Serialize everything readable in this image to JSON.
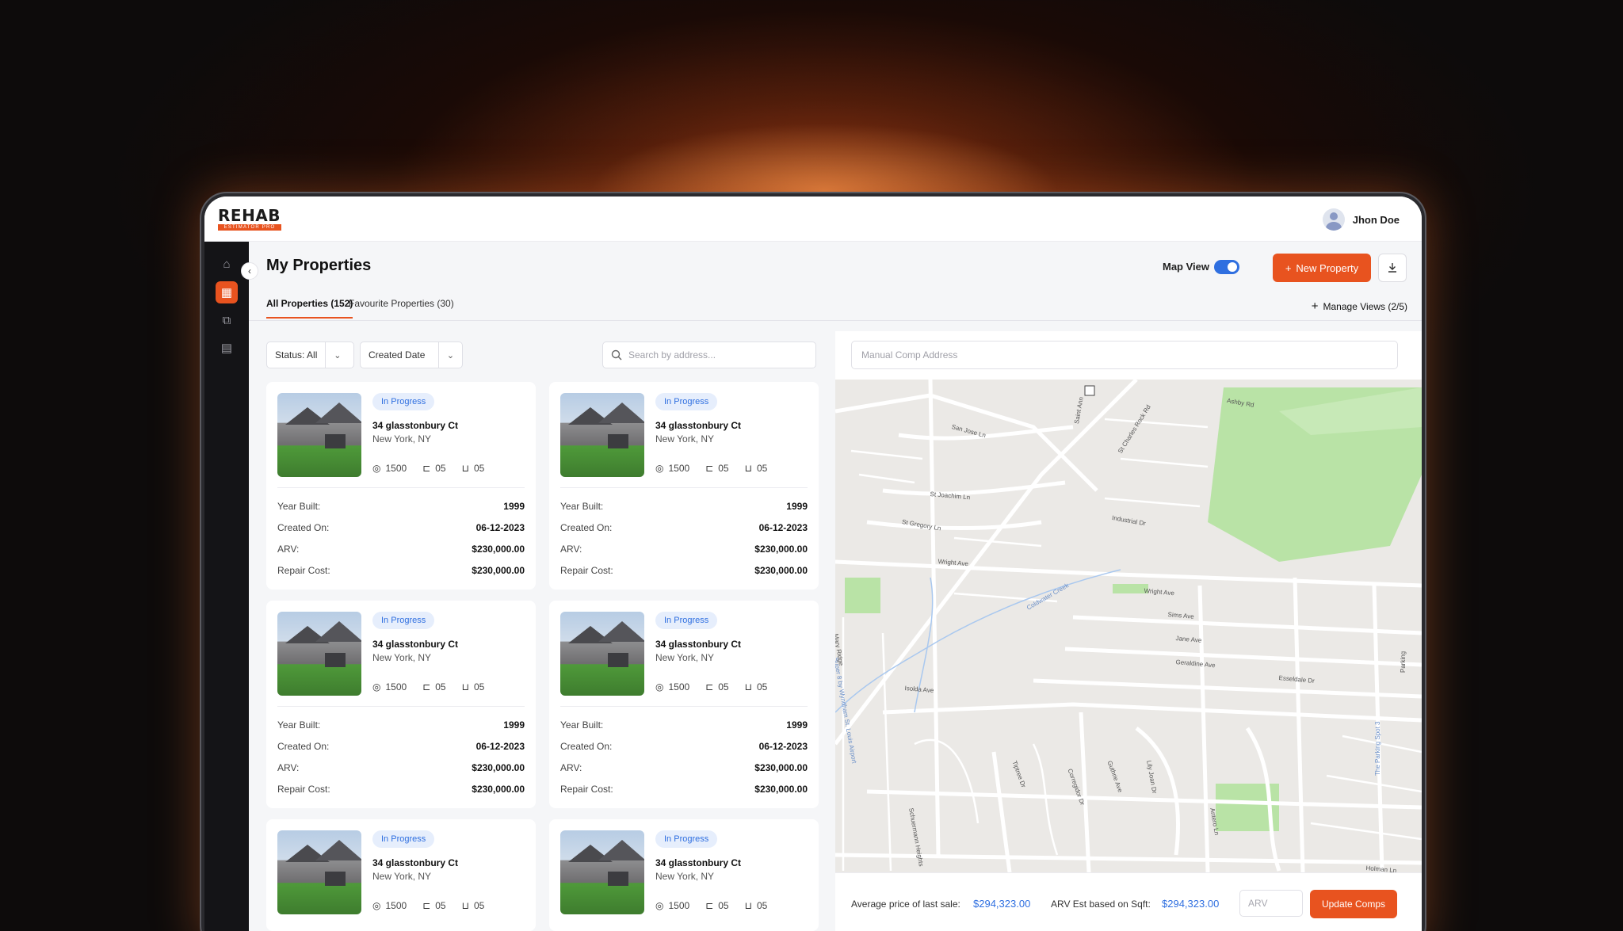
{
  "app": {
    "logo_main": "REHAB",
    "logo_sub": "ESTIMATOR PRO",
    "user_name": "Jhon Doe"
  },
  "sidebar": {
    "items": [
      {
        "icon": "home-icon",
        "glyph": "⌂"
      },
      {
        "icon": "building-icon",
        "glyph": "▦",
        "active": true
      },
      {
        "icon": "copy-icon",
        "glyph": "⧉"
      },
      {
        "icon": "document-icon",
        "glyph": "▤"
      }
    ]
  },
  "header": {
    "title": "My Properties",
    "map_view_label": "Map View",
    "map_view_on": true,
    "new_property_label": "New Property",
    "new_property_icon": "+"
  },
  "tabs": [
    {
      "label": "All Properties (152)",
      "active": true
    },
    {
      "label": "Favourite Properties (30)",
      "active": false
    }
  ],
  "manage_views_label": "Manage Views (2/5)",
  "filters": {
    "status_label": "Status: All",
    "sort_label": "Created Date",
    "search_placeholder": "Search by address..."
  },
  "cards": [
    {
      "status": "In Progress",
      "address": "34 glasstonbury Ct",
      "city": "New York, NY",
      "sqft": "1500",
      "beds": "05",
      "baths": "05",
      "rows": [
        {
          "k": "Year Built:",
          "v": "1999"
        },
        {
          "k": "Created On:",
          "v": "06-12-2023"
        },
        {
          "k": "ARV:",
          "v": "$230,000.00"
        },
        {
          "k": "Repair Cost:",
          "v": "$230,000.00"
        }
      ]
    },
    {
      "status": "In Progress",
      "address": "34 glasstonbury Ct",
      "city": "New York, NY",
      "sqft": "1500",
      "beds": "05",
      "baths": "05",
      "rows": [
        {
          "k": "Year Built:",
          "v": "1999"
        },
        {
          "k": "Created On:",
          "v": "06-12-2023"
        },
        {
          "k": "ARV:",
          "v": "$230,000.00"
        },
        {
          "k": "Repair Cost:",
          "v": "$230,000.00"
        }
      ]
    },
    {
      "status": "In Progress",
      "address": "34 glasstonbury Ct",
      "city": "New York, NY",
      "sqft": "1500",
      "beds": "05",
      "baths": "05",
      "rows": [
        {
          "k": "Year Built:",
          "v": "1999"
        },
        {
          "k": "Created On:",
          "v": "06-12-2023"
        },
        {
          "k": "ARV:",
          "v": "$230,000.00"
        },
        {
          "k": "Repair Cost:",
          "v": "$230,000.00"
        }
      ]
    },
    {
      "status": "In Progress",
      "address": "34 glasstonbury Ct",
      "city": "New York, NY",
      "sqft": "1500",
      "beds": "05",
      "baths": "05",
      "rows": [
        {
          "k": "Year Built:",
          "v": "1999"
        },
        {
          "k": "Created On:",
          "v": "06-12-2023"
        },
        {
          "k": "ARV:",
          "v": "$230,000.00"
        },
        {
          "k": "Repair Cost:",
          "v": "$230,000.00"
        }
      ]
    },
    {
      "status": "In Progress",
      "address": "34 glasstonbury Ct",
      "city": "New York, NY",
      "sqft": "1500",
      "beds": "05",
      "baths": "05",
      "rows": []
    },
    {
      "status": "In Progress",
      "address": "34 glasstonbury Ct",
      "city": "New York, NY",
      "sqft": "1500",
      "beds": "05",
      "baths": "05",
      "rows": []
    }
  ],
  "map_panel": {
    "comp_placeholder": "Manual Comp Address",
    "street_labels": [
      "Ashby Rd",
      "San Jose Ln",
      "Saint Ann",
      "St Charles Rock Rd",
      "St Joachim Ln",
      "Industrial Dr",
      "St Gregory Ln",
      "Wright Ave",
      "Wright Ave",
      "Sims Ave",
      "Jane Ave",
      "Geraldine Ave",
      "Esseldale Dr",
      "Isolda Ave",
      "Mary Ridge",
      "Coldwater Creek",
      "Schuermann Heights",
      "Holman Ln",
      "Tiptree Dr",
      "Corregidor Dr",
      "Guthrie Ave",
      "Lily Joan Dr",
      "Antero Ln",
      "Parking",
      "The Parking Spot 3",
      "Super 8 by Wyndham St. Louis Airport"
    ],
    "avg_price_label": "Average price of last sale:",
    "avg_price_value": "$294,323.00",
    "arv_est_label": "ARV Est based on Sqft:",
    "arv_est_value": "$294,323.00",
    "arv_placeholder": "ARV",
    "update_label": "Update Comps"
  },
  "colors": {
    "accent": "#e8531f",
    "link_blue": "#2f6fe0",
    "sidebar_bg": "#141417"
  }
}
